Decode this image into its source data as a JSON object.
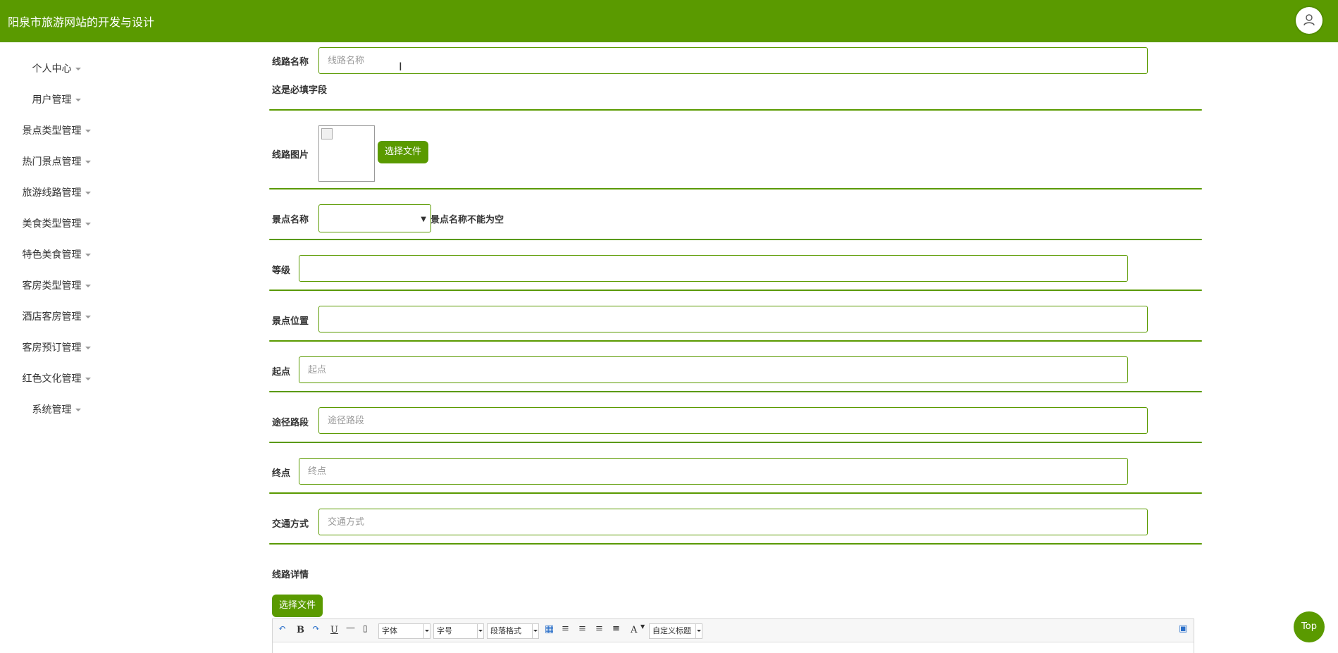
{
  "app": {
    "title": "阳泉市旅游网站的开发与设计"
  },
  "sidebar": {
    "items": [
      {
        "label": "个人中心"
      },
      {
        "label": "用户管理"
      },
      {
        "label": "景点类型管理"
      },
      {
        "label": "热门景点管理"
      },
      {
        "label": "旅游线路管理"
      },
      {
        "label": "美食类型管理"
      },
      {
        "label": "特色美食管理"
      },
      {
        "label": "客房类型管理"
      },
      {
        "label": "酒店客房管理"
      },
      {
        "label": "客房预订管理"
      },
      {
        "label": "红色文化管理"
      },
      {
        "label": "系统管理"
      }
    ]
  },
  "form": {
    "route_name": {
      "label": "线路名称",
      "placeholder": "线路名称",
      "hint": "这是必填字段"
    },
    "route_image": {
      "label": "线路图片",
      "button": "选择文件"
    },
    "spot_name": {
      "label": "景点名称",
      "error": "景点名称不能为空"
    },
    "level": {
      "label": "等级"
    },
    "location": {
      "label": "景点位置"
    },
    "start": {
      "label": "起点",
      "placeholder": "起点"
    },
    "via": {
      "label": "途径路段",
      "placeholder": "途径路段"
    },
    "end": {
      "label": "终点",
      "placeholder": "终点"
    },
    "transport": {
      "label": "交通方式",
      "placeholder": "交通方式"
    },
    "details": {
      "label": "线路详情",
      "button": "选择文件"
    }
  },
  "editor": {
    "toolbar": {
      "font": "字体",
      "size": "字号",
      "paragraph": "段落格式",
      "custom_title": "自定义标题",
      "bold": "B",
      "italic_a": "A"
    }
  },
  "top_button": {
    "label": "Top"
  },
  "colors": {
    "accent": "#5a9a00"
  }
}
